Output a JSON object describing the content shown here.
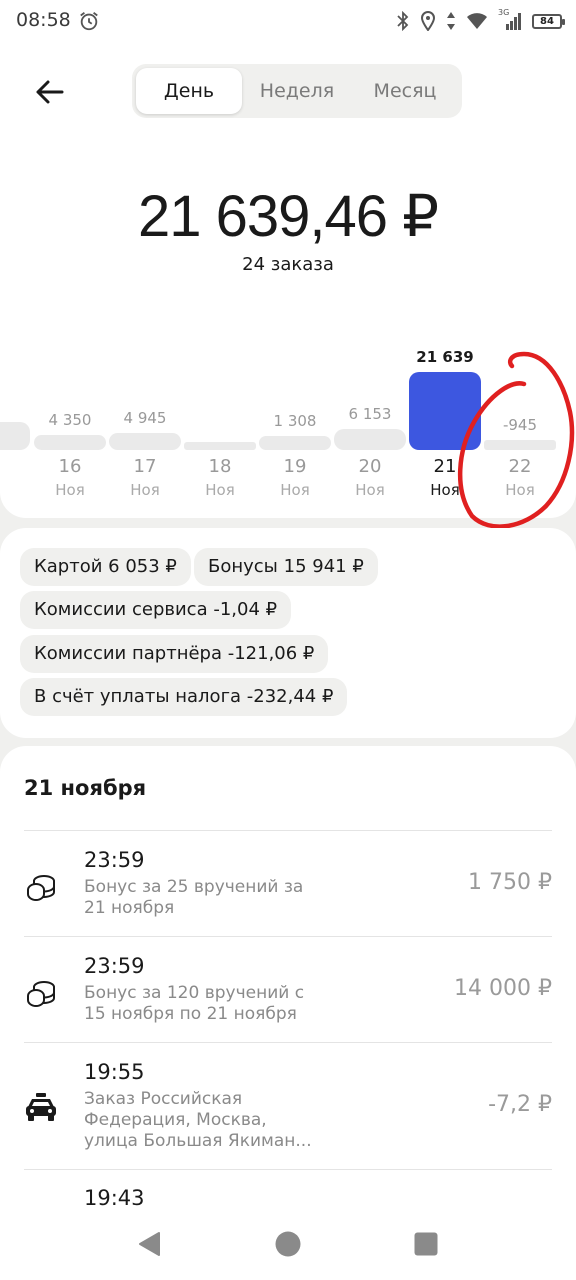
{
  "status_bar": {
    "time": "08:58",
    "network": "3G",
    "battery": "84",
    "icons": [
      "alarm-icon",
      "bluetooth-icon",
      "location-icon",
      "data-arrows-icon",
      "wifi-icon",
      "signal-icon",
      "battery-icon"
    ]
  },
  "header": {
    "back_icon": "arrow-left-icon",
    "tabs": [
      {
        "label": "День",
        "active": true
      },
      {
        "label": "Неделя",
        "active": false
      },
      {
        "label": "Месяц",
        "active": false
      }
    ]
  },
  "summary": {
    "amount": "21 639,46 ₽",
    "orders": "24 заказа"
  },
  "chart_data": {
    "type": "bar",
    "categories": [
      "16 Ноя",
      "17 Ноя",
      "18 Ноя",
      "19 Ноя",
      "20 Ноя",
      "21 Ноя",
      "22 Ноя"
    ],
    "days": [
      {
        "num": "16",
        "mon": "Ноя",
        "label": "4 350",
        "value": 4350
      },
      {
        "num": "17",
        "mon": "Ноя",
        "label": "4 945",
        "value": 4945
      },
      {
        "num": "18",
        "mon": "Ноя",
        "label": "",
        "value": 0
      },
      {
        "num": "19",
        "mon": "Ноя",
        "label": "1 308",
        "value": 1308
      },
      {
        "num": "20",
        "mon": "Ноя",
        "label": "6 153",
        "value": 6153
      },
      {
        "num": "21",
        "mon": "Ноя",
        "label": "21 639",
        "value": 21639,
        "selected": true
      },
      {
        "num": "22",
        "mon": "Ноя",
        "label": "-945",
        "value": -945
      }
    ],
    "values": [
      4350,
      4945,
      0,
      1308,
      6153,
      21639,
      -945
    ],
    "selected_color": "#3d57e0",
    "bar_color": "#eaeaea",
    "annotation": "red hand-drawn circle around 22 Ноя"
  },
  "chips": [
    "Картой 6 053 ₽",
    "Бонусы 15 941 ₽",
    "Комиссии сервиса -1,04 ₽",
    "Комиссии партнёра -121,06 ₽",
    "В счёт уплаты налога -232,44 ₽"
  ],
  "list": {
    "date": "21 ноября",
    "items": [
      {
        "icon": "coins-icon",
        "time": "23:59",
        "desc1": "Бонус за 25 вручений за",
        "desc2": "21 ноября",
        "desc3": "",
        "amount": "1 750 ₽"
      },
      {
        "icon": "coins-icon",
        "time": "23:59",
        "desc1": "Бонус за 120 вручений с",
        "desc2": "15 ноября по 21 ноября",
        "desc3": "",
        "amount": "14 000 ₽"
      },
      {
        "icon": "taxi-icon",
        "time": "19:55",
        "desc1": "Заказ Российская",
        "desc2": "Федерация, Москва,",
        "desc3": "улица Большая Якиман...",
        "amount": "-7,2 ₽"
      },
      {
        "icon": "",
        "time": "19:43",
        "desc1": "",
        "desc2": "",
        "desc3": "",
        "amount": ""
      }
    ]
  },
  "nav": {
    "icons": [
      "back-triangle-icon",
      "home-circle-icon",
      "recents-square-icon"
    ]
  },
  "colors": {
    "accent": "#3d57e0",
    "annotation": "#e02020",
    "background": "#f0f0ee"
  }
}
